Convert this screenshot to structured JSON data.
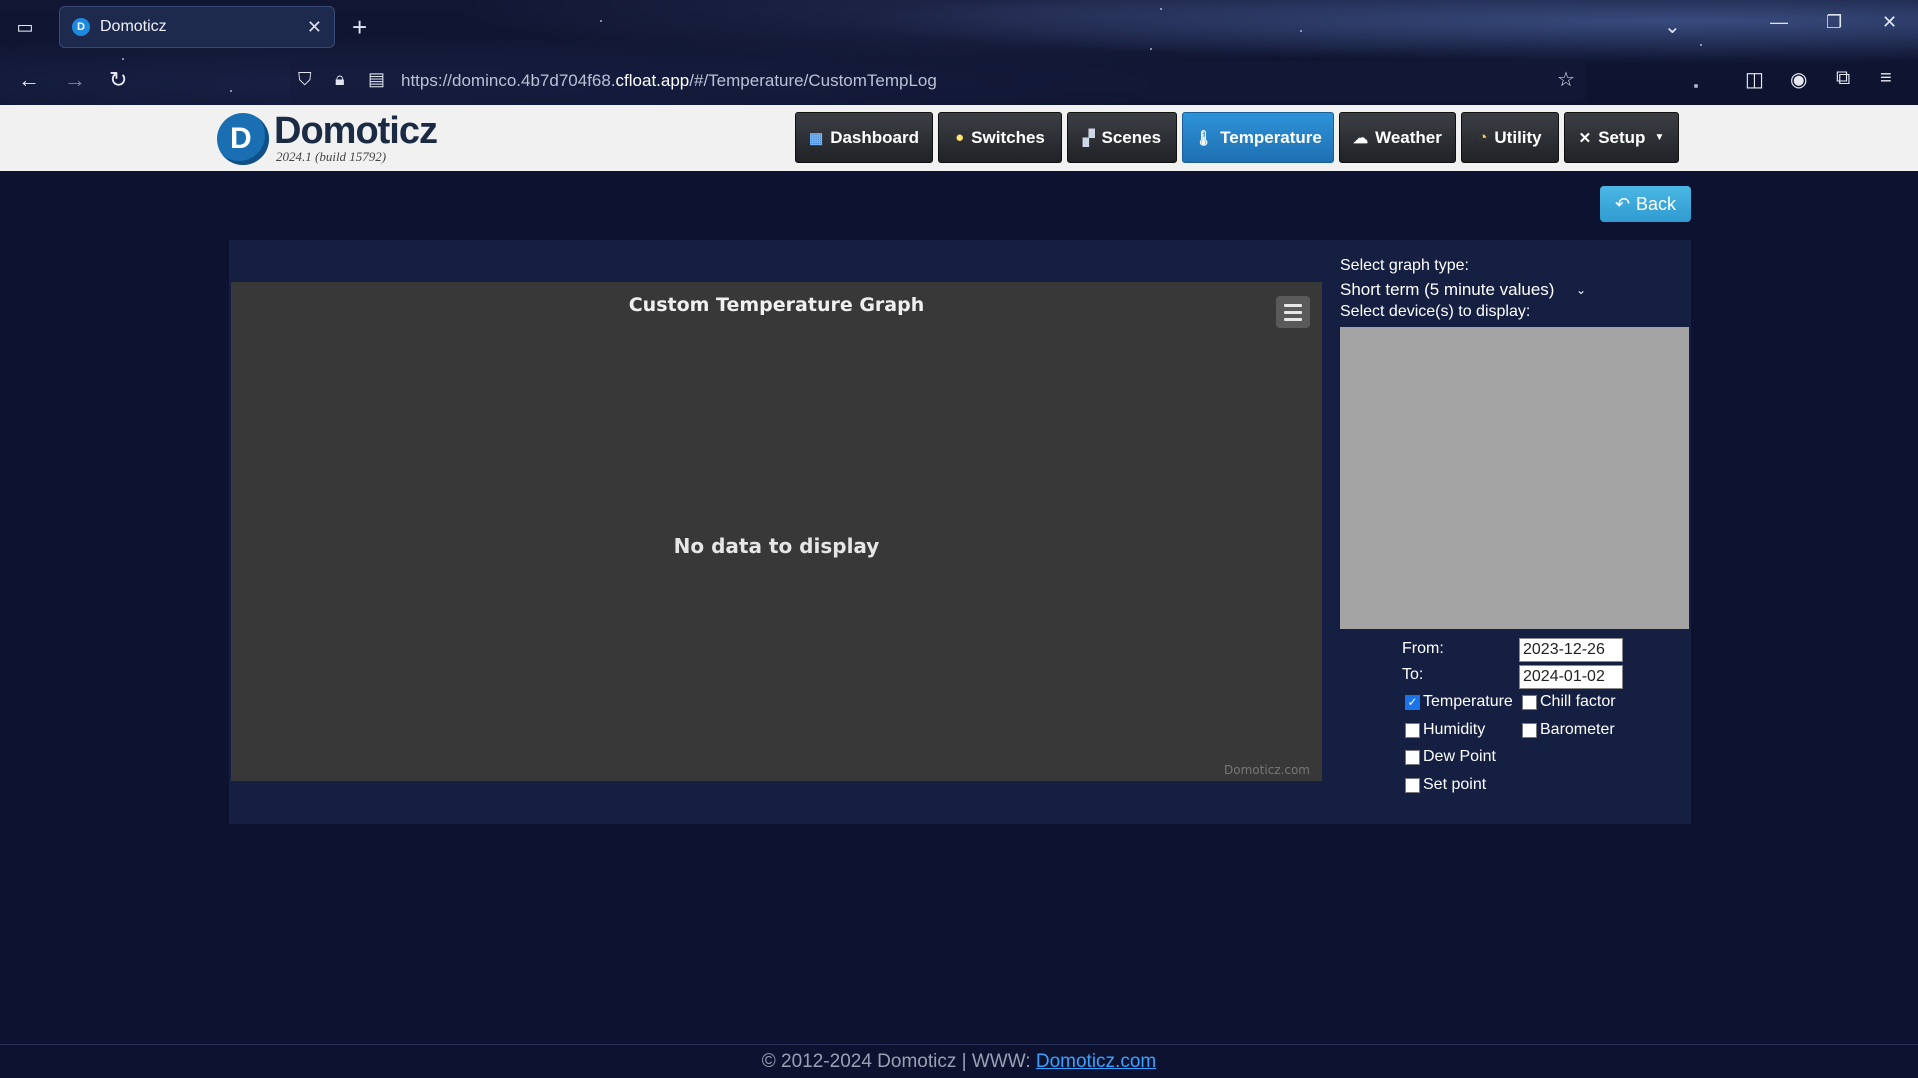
{
  "browser": {
    "tab_title": "Domoticz",
    "url_prefix": "https://dominco.4b7d704f68.",
    "url_host": "cfloat.app",
    "url_path": "/#/Temperature/CustomTempLog"
  },
  "app": {
    "name": "Domoticz",
    "version": "2024.1 (build 15792)"
  },
  "nav": [
    {
      "label": "Dashboard",
      "icon": "dashboard-icon"
    },
    {
      "label": "Switches",
      "icon": "lightbulb-icon"
    },
    {
      "label": "Scenes",
      "icon": "clapperboard-icon"
    },
    {
      "label": "Temperature",
      "icon": "thermometer-icon",
      "active": true
    },
    {
      "label": "Weather",
      "icon": "cloud-icon"
    },
    {
      "label": "Utility",
      "icon": "gauge-icon"
    },
    {
      "label": "Setup",
      "icon": "tools-icon",
      "has_dropdown": true
    }
  ],
  "back_label": "Back",
  "chart": {
    "title": "Custom Temperature Graph",
    "no_data": "No data to display",
    "credits": "Domoticz.com"
  },
  "chart_data": {
    "type": "line",
    "title": "Custom Temperature Graph",
    "series": [],
    "message": "No data to display"
  },
  "controls": {
    "graph_type_label": "Select graph type:",
    "graph_type_value": "Short term (5 minute values)",
    "devices_label": "Select device(s) to display:",
    "from_label": "From:",
    "from_value": "2023-12-26",
    "to_label": "To:",
    "to_value": "2024-01-02",
    "checkboxes": [
      {
        "label": "Temperature",
        "checked": true
      },
      {
        "label": "Chill factor",
        "checked": false
      },
      {
        "label": "Humidity",
        "checked": false
      },
      {
        "label": "Barometer",
        "checked": false
      },
      {
        "label": "Dew Point",
        "checked": false
      },
      {
        "label": "Set point",
        "checked": false
      }
    ]
  },
  "footer": {
    "text": "© 2012-2024 Domoticz | WWW: ",
    "link": "Domoticz.com"
  },
  "colors": {
    "page_bg": "#0d1230",
    "panel_bg": "#141f42",
    "chart_bg": "#383838",
    "accent": "#2f93d8"
  }
}
